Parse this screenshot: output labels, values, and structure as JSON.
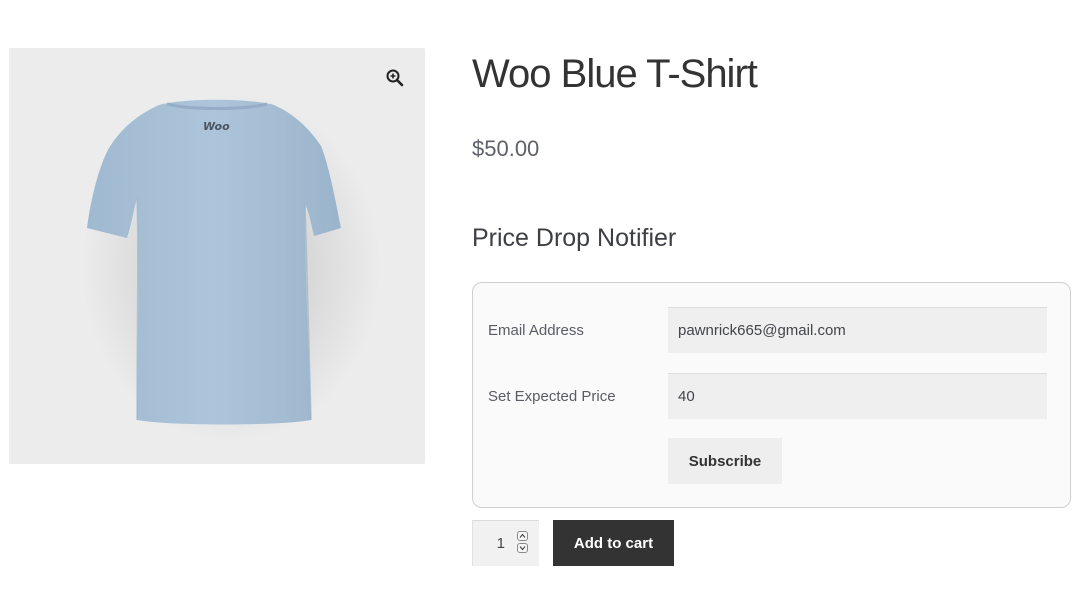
{
  "product": {
    "title": "Woo Blue T-Shirt",
    "price": "$50.00",
    "image": {
      "logo_text": "Woo",
      "shirt_color": "#a9c2d8"
    }
  },
  "notifier": {
    "heading": "Price Drop Notifier",
    "email_label": "Email Address",
    "email_value": "pawnrick665@gmail.com",
    "price_label": "Set Expected Price",
    "price_value": "40",
    "subscribe_label": "Subscribe"
  },
  "cart": {
    "quantity": "1",
    "add_to_cart_label": "Add to cart"
  },
  "colors": {
    "button_dark": "#333333",
    "input_bg": "#efefef"
  },
  "icons": {
    "zoom": "magnifier-plus-icon",
    "qty_up": "chevron-up-icon",
    "qty_down": "chevron-down-icon"
  }
}
